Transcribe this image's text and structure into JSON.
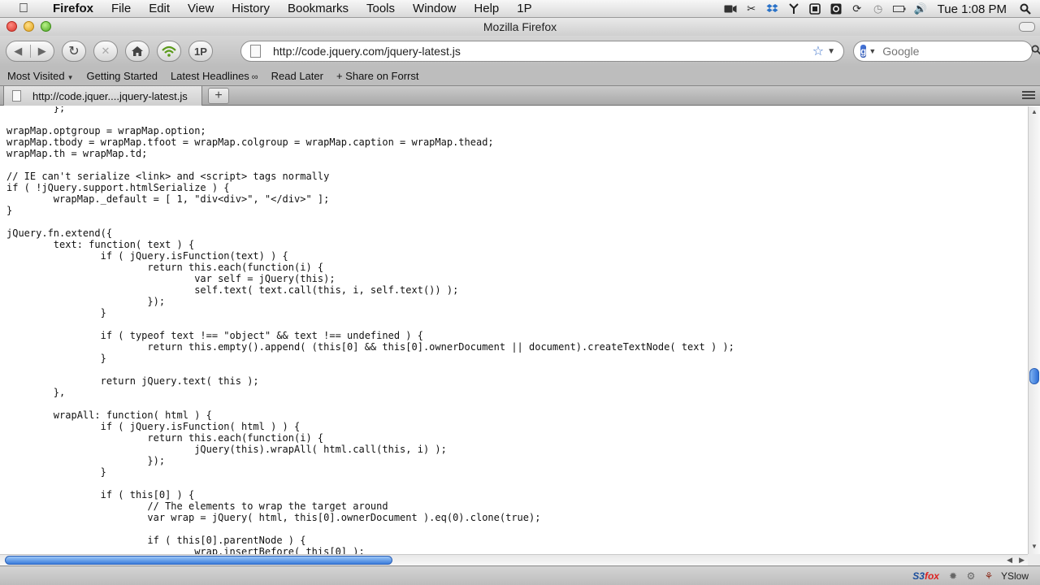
{
  "menubar": {
    "app_name": "Firefox",
    "items": [
      "File",
      "Edit",
      "View",
      "History",
      "Bookmarks",
      "Tools",
      "Window",
      "Help",
      "1P"
    ],
    "clock": "Tue 1:08 PM"
  },
  "window": {
    "title": "Mozilla Firefox"
  },
  "toolbar": {
    "onepassword_label": "1P",
    "url": "http://code.jquery.com/jquery-latest.js",
    "search_placeholder": "Google"
  },
  "bookmarks": {
    "most_visited": "Most Visited",
    "getting_started": "Getting Started",
    "latest_headlines": "Latest Headlines",
    "read_later": "Read Later",
    "share_on_forrst": "+ Share on Forrst"
  },
  "tabs": [
    {
      "title": "http://code.jquer....jquery-latest.js"
    }
  ],
  "new_tab_label": "+",
  "content": {
    "code": "\t};\n\nwrapMap.optgroup = wrapMap.option;\nwrapMap.tbody = wrapMap.tfoot = wrapMap.colgroup = wrapMap.caption = wrapMap.thead;\nwrapMap.th = wrapMap.td;\n\n// IE can't serialize <link> and <script> tags normally\nif ( !jQuery.support.htmlSerialize ) {\n\twrapMap._default = [ 1, \"div<div>\", \"</div>\" ];\n}\n\njQuery.fn.extend({\n\ttext: function( text ) {\n\t\tif ( jQuery.isFunction(text) ) {\n\t\t\treturn this.each(function(i) {\n\t\t\t\tvar self = jQuery(this);\n\t\t\t\tself.text( text.call(this, i, self.text()) );\n\t\t\t});\n\t\t}\n\n\t\tif ( typeof text !== \"object\" && text !== undefined ) {\n\t\t\treturn this.empty().append( (this[0] && this[0].ownerDocument || document).createTextNode( text ) );\n\t\t}\n\n\t\treturn jQuery.text( this );\n\t},\n\n\twrapAll: function( html ) {\n\t\tif ( jQuery.isFunction( html ) ) {\n\t\t\treturn this.each(function(i) {\n\t\t\t\tjQuery(this).wrapAll( html.call(this, i) );\n\t\t\t});\n\t\t}\n\n\t\tif ( this[0] ) {\n\t\t\t// The elements to wrap the target around\n\t\t\tvar wrap = jQuery( html, this[0].ownerDocument ).eq(0).clone(true);\n\n\t\t\tif ( this[0].parentNode ) {\n\t\t\t\twrap.insertBefore( this[0] );"
  },
  "statusbar": {
    "yslow_label": "YSlow"
  },
  "colors": {
    "scroll_thumb": "#3b7ddb",
    "bookmark_star": "#3a70c9"
  }
}
